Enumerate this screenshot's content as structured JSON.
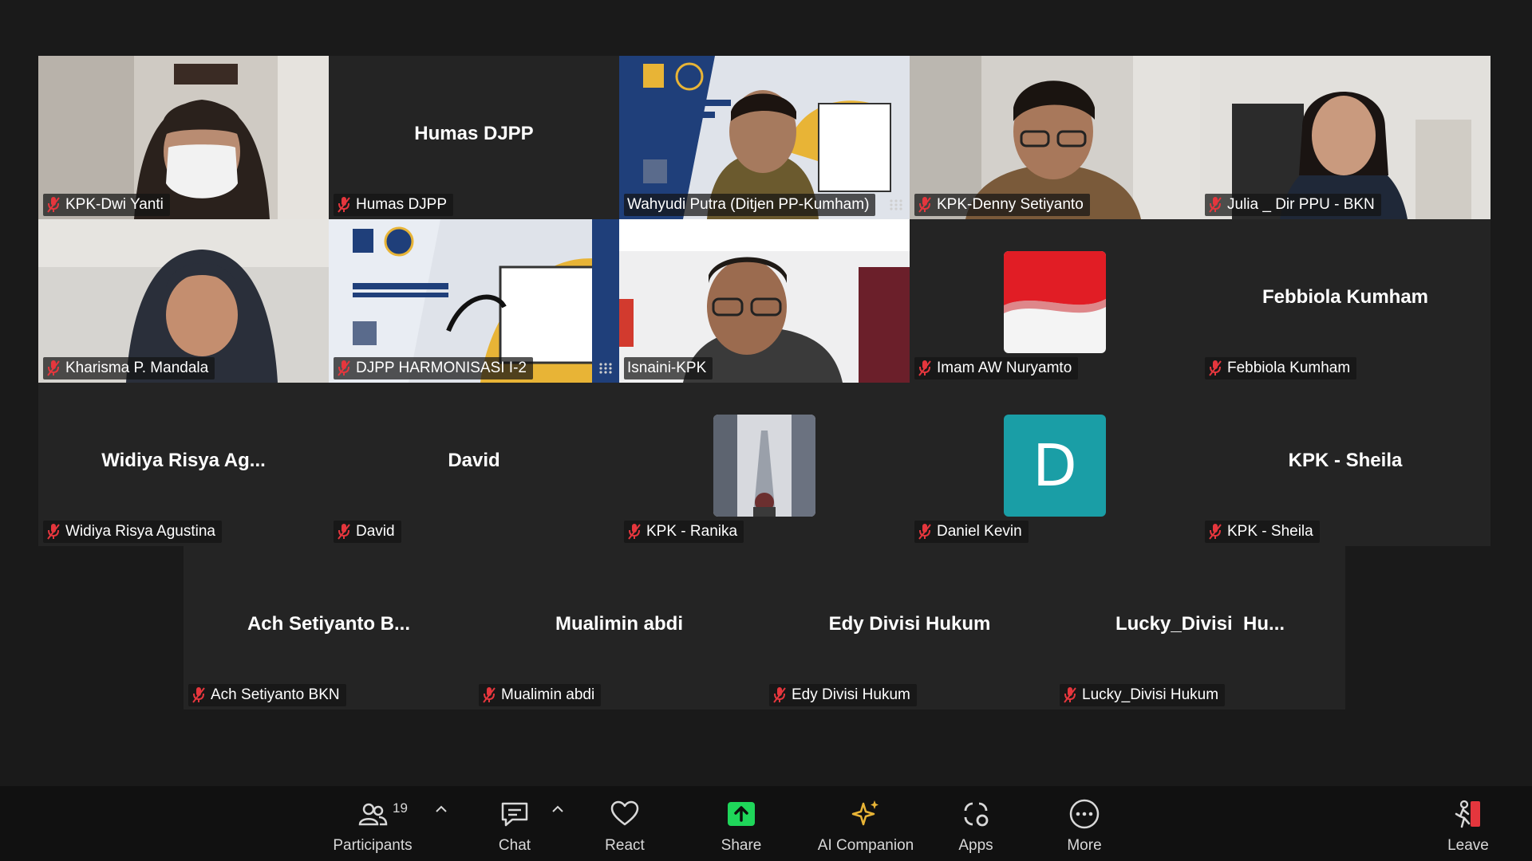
{
  "tiles": [
    {
      "id": "t1",
      "label": "KPK-Dwi Yanti",
      "big_name": "",
      "kind": "video-woman-mask"
    },
    {
      "id": "t2",
      "label": "Humas DJPP",
      "big_name": "Humas DJPP",
      "kind": "name"
    },
    {
      "id": "t3",
      "label": "Wahyudi Putra (Ditjen PP-Kumham)",
      "big_name": "",
      "kind": "video-man-banner",
      "active": true
    },
    {
      "id": "t4",
      "label": "KPK-Denny Setiyanto",
      "big_name": "",
      "kind": "video-man"
    },
    {
      "id": "t5",
      "label": "Julia _ Dir PPU - BKN",
      "big_name": "",
      "kind": "video-woman"
    },
    {
      "id": "t6",
      "label": "Kharisma P. Mandala",
      "big_name": "",
      "kind": "video-woman-hijab"
    },
    {
      "id": "t7",
      "label": "DJPP HARMONISASI I-2",
      "big_name": "",
      "kind": "video-banner"
    },
    {
      "id": "t8",
      "label": "Isnaini-KPK",
      "big_name": "",
      "kind": "video-man-glasses"
    },
    {
      "id": "t9",
      "label": "Imam AW Nuryamto",
      "big_name": "",
      "kind": "avatar-flag"
    },
    {
      "id": "t10",
      "label": "Febbiola Kumham",
      "big_name": "Febbiola Kumham",
      "kind": "name"
    },
    {
      "id": "t11",
      "label": "Widiya Risya Agustina",
      "big_name": "Widiya Risya Ag...",
      "kind": "name"
    },
    {
      "id": "t12",
      "label": "David",
      "big_name": "David",
      "kind": "name"
    },
    {
      "id": "t13",
      "label": "KPK - Ranika",
      "big_name": "",
      "kind": "avatar-photo"
    },
    {
      "id": "t14",
      "label": "Daniel Kevin",
      "big_name": "",
      "kind": "avatar-letter",
      "letter": "D"
    },
    {
      "id": "t15",
      "label": "KPK - Sheila",
      "big_name": "KPK - Sheila",
      "kind": "name"
    },
    {
      "id": "t16",
      "label": "Ach Setiyanto BKN",
      "big_name": "Ach Setiyanto B...",
      "kind": "name"
    },
    {
      "id": "t17",
      "label": "Mualimin abdi",
      "big_name": "Mualimin abdi",
      "kind": "name"
    },
    {
      "id": "t18",
      "label": "Edy Divisi Hukum",
      "big_name": "Edy Divisi Hukum",
      "kind": "name"
    },
    {
      "id": "t19",
      "label": "Lucky_Divisi Hukum",
      "big_name": "Lucky_Divisi  Hu...",
      "kind": "name"
    }
  ],
  "toolbar": {
    "participants_label": "Participants",
    "participants_count": "19",
    "chat_label": "Chat",
    "react_label": "React",
    "share_label": "Share",
    "ai_label": "AI Companion",
    "apps_label": "Apps",
    "more_label": "More",
    "leave_label": "Leave"
  },
  "colors": {
    "active_speaker": "#23d959",
    "share_green": "#1fd65a",
    "leave_red": "#e5363d",
    "ai_gold": "#e8b436",
    "daniel_avatar": "#1a9ea6"
  }
}
